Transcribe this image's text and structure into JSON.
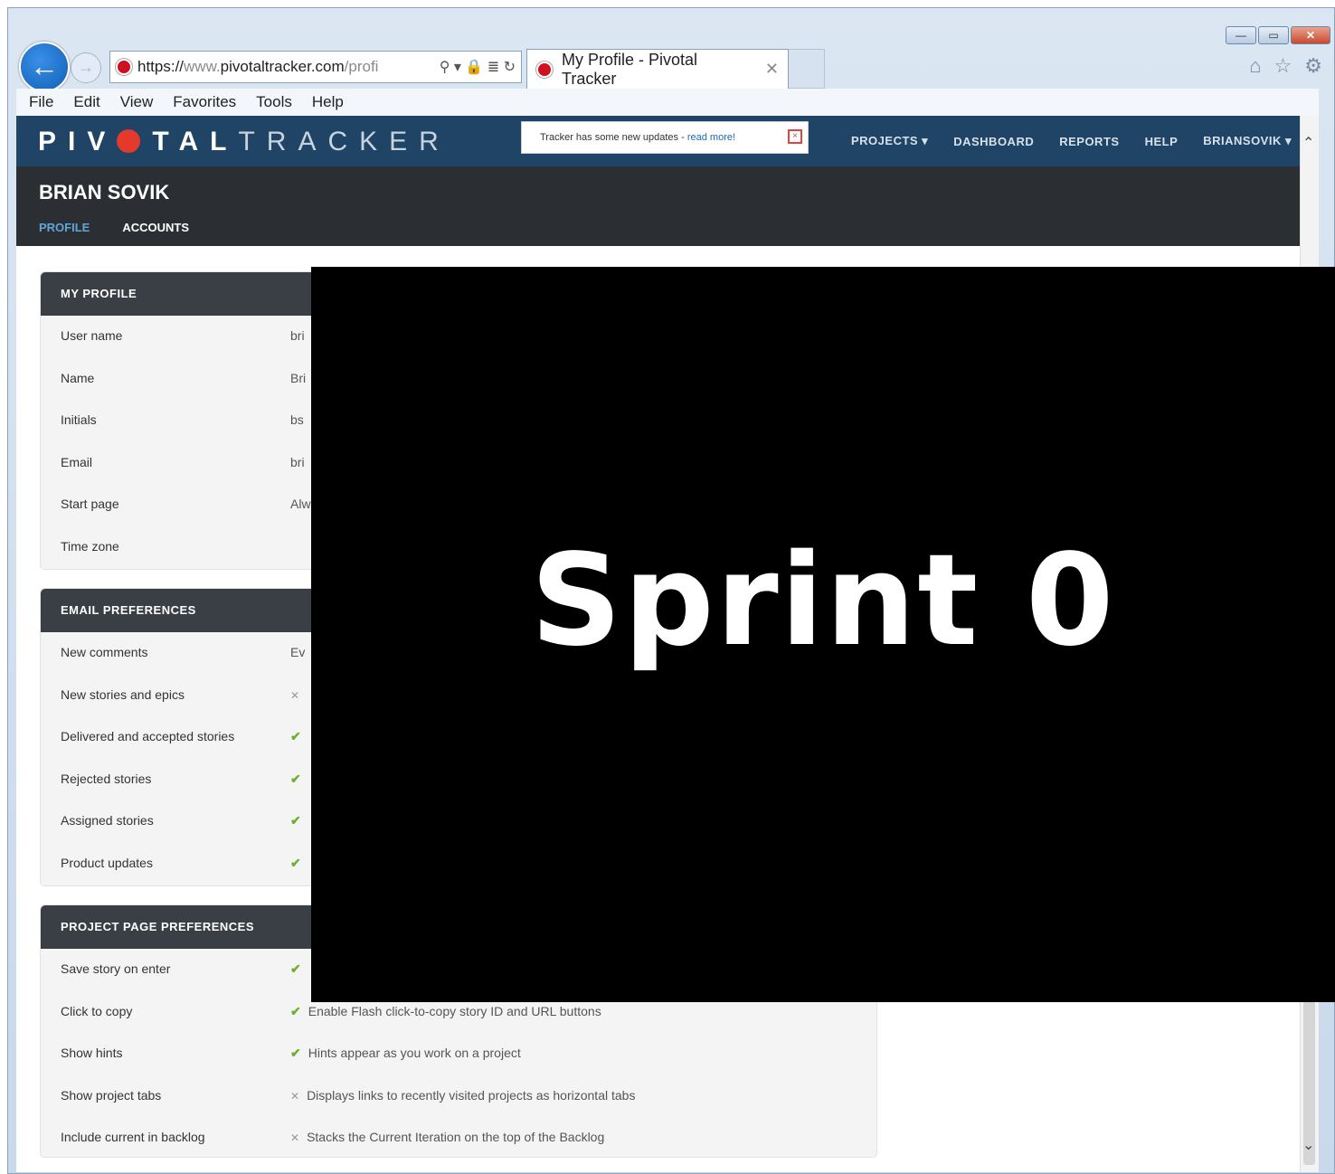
{
  "browser": {
    "window_controls": {
      "minimize": "—",
      "maximize": "▭",
      "close": "✕"
    },
    "address": {
      "protocol": "https://",
      "www": "www.",
      "domain": "pivotaltracker.com",
      "path": "/profi"
    },
    "address_icons": "⚲ ▾ 🔒 ≣ ↻",
    "tab_title": "My Profile - Pivotal Tracker",
    "tab_close": "✕",
    "menu": [
      "File",
      "Edit",
      "View",
      "Favorites",
      "Tools",
      "Help"
    ],
    "toolbar_icons": [
      "home-icon",
      "favorites-star-icon",
      "settings-icon"
    ]
  },
  "app": {
    "logo_bold": "PIV",
    "logo_rest_bold": "TAL",
    "logo_light": "TRACKER",
    "notice_text": "Tracker has some new updates - ",
    "notice_link": "read more!",
    "nav": [
      "PROJECTS ▾",
      "DASHBOARD",
      "REPORTS",
      "HELP",
      "BRIANSOVIK ▾"
    ],
    "user_heading": "BRIAN SOVIK",
    "subtabs": {
      "profile": "PROFILE",
      "accounts": "ACCOUNTS"
    }
  },
  "sections": {
    "my_profile": {
      "title": "MY PROFILE",
      "rows": [
        {
          "label": "User name",
          "value": "bri"
        },
        {
          "label": "Name",
          "value": "Bri"
        },
        {
          "label": "Initials",
          "value": "bs"
        },
        {
          "label": "Email",
          "value": "bri"
        },
        {
          "label": "Start page",
          "value": "Alw"
        },
        {
          "label": "Time zone",
          "value": ""
        }
      ]
    },
    "email_preferences": {
      "title": "EMAIL PREFERENCES",
      "rows": [
        {
          "label": "New comments",
          "value": "Ev"
        },
        {
          "label": "New stories and epics",
          "value": ""
        },
        {
          "label": "Delivered and accepted stories",
          "value": ""
        },
        {
          "label": "Rejected stories",
          "value": ""
        },
        {
          "label": "Assigned stories",
          "value": ""
        },
        {
          "label": "Product updates",
          "value": ""
        }
      ]
    },
    "project_page_preferences": {
      "title": "PROJECT PAGE PREFERENCES",
      "rows": [
        {
          "label": "Save story on enter",
          "value": ""
        },
        {
          "label": "Click to copy",
          "value": "Enable Flash click-to-copy story ID and URL buttons"
        },
        {
          "label": "Show hints",
          "value": "Hints appear as you work on a project"
        },
        {
          "label": "Show project tabs",
          "value": "Displays links to recently visited projects as horizontal tabs"
        },
        {
          "label": "Include current in backlog",
          "value": "Stacks the Current Iteration on the top of the Backlog"
        }
      ]
    }
  },
  "overlay": {
    "title": "Sprint 0"
  }
}
